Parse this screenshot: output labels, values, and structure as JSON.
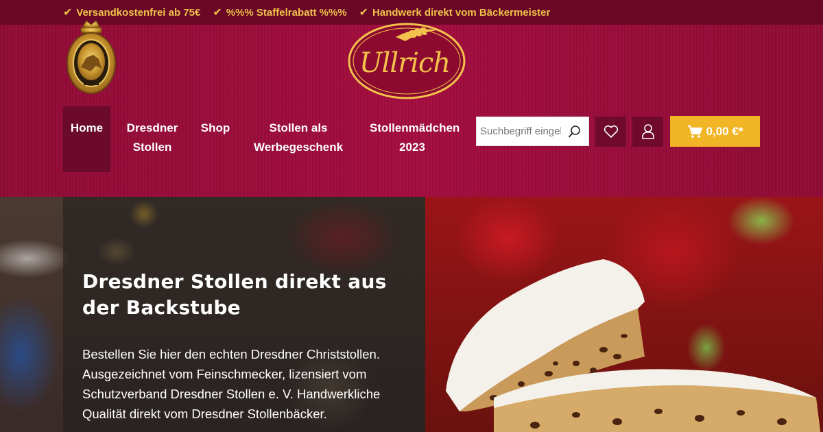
{
  "topbar": {
    "usps": [
      {
        "icon": "check-icon",
        "text": "Versandkostenfrei ab 75€"
      },
      {
        "icon": "check-icon",
        "text": "%%% Staffelrabatt %%%"
      },
      {
        "icon": "check-icon",
        "text": "Handwerk direkt vom Bäckermeister"
      }
    ]
  },
  "header": {
    "logo_text": "Ullrich",
    "nav": [
      {
        "label": "Home",
        "active": true
      },
      {
        "label": "Dresdner Stollen"
      },
      {
        "label": "Shop"
      },
      {
        "label": "Stollen als Werbegeschenk"
      },
      {
        "label": "Stollenmädchen 2023"
      }
    ],
    "search": {
      "placeholder": "Suchbegriff eingeben...",
      "icon": "search-icon"
    },
    "wishlist_icon": "heart-icon",
    "account_icon": "user-icon",
    "cart": {
      "icon": "cart-icon",
      "amount": "0,00 €*"
    }
  },
  "hero": {
    "title": "Dresdner Stollen direkt aus der Backstube",
    "text": "Bestellen Sie hier den echten Dresdner Christstollen. Ausgezeichnet vom Feinschmecker, lizensiert vom Schutzverband Dresdner Stollen e. V. Handwerkliche Qualität direkt vom Dresdner Stollenbäcker."
  },
  "colors": {
    "brand": "#a30c3e",
    "topbar": "#6a0726",
    "accent": "#f0c24a",
    "cart": "#f2b526"
  }
}
